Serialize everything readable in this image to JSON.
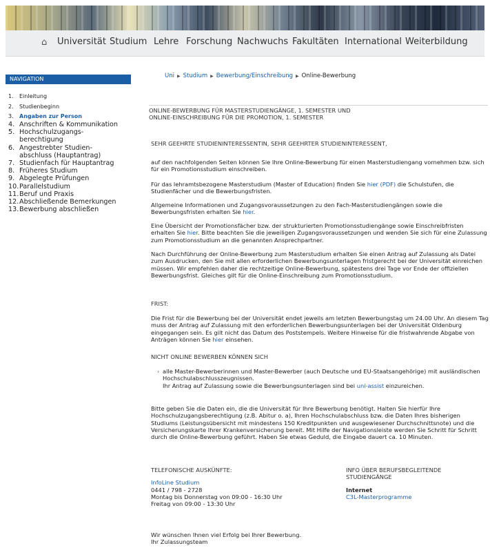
{
  "header": {
    "nav": [
      "Universität",
      "Studium",
      "Lehre",
      "Forschung",
      "Nachwuchs",
      "Fakultäten",
      "International",
      "Weiterbildung"
    ],
    "home_icon": "home-icon"
  },
  "sidebar": {
    "heading": "NAVIGATION",
    "items": [
      {
        "num": "1.",
        "label": "Einleitung"
      },
      {
        "num": "2.",
        "label": "Studienbeginn"
      },
      {
        "num": "3.",
        "label": "Angaben zur Person"
      },
      {
        "num": "4.",
        "label": "Anschriften & Kommunikation"
      },
      {
        "num": "5.",
        "label": "Hochschulzugangs-"
      },
      {
        "num": "",
        "label": "berechtigung"
      },
      {
        "num": "6.",
        "label": "Angestrebter Studien-"
      },
      {
        "num": "",
        "label": "abschluss (Hauptantrag)"
      },
      {
        "num": "7.",
        "label": "Studienfach für Hauptantrag"
      },
      {
        "num": "8.",
        "label": "Früheres Studium"
      },
      {
        "num": "9.",
        "label": "Abgelegte Prüfungen"
      },
      {
        "num": "10.",
        "label": "Parallelstudium"
      },
      {
        "num": "11.",
        "label": "Beruf und Praxis"
      },
      {
        "num": "12.",
        "label": "Abschließende Bemerkungen"
      },
      {
        "num": "13.",
        "label": "Bewerbung abschließen"
      }
    ]
  },
  "breadcrumb": {
    "items": [
      "Uni",
      "Studium",
      "Bewerbung/Einschreibung"
    ],
    "current": "Online-Bewerbung"
  },
  "content": {
    "title_line1": "ONLINE-BEWERBUNG FÜR MASTERSTUDIENGÄNGE, 1. SEMESTER UND",
    "title_line2": "ONLINE-EINSCHREIBUNG FÜR DIE PROMOTION, 1. SEMESTER",
    "greeting": "SEHR GEEHRTE STUDIENINTERESSENTIN, SEHR GEEHRTER STUDIENINTERESSENT,",
    "p1": "auf den nachfolgenden Seiten können Sie Ihre Online-Bewerbung für einen Masterstudiengang vornehmen bzw. sich für ein Promotionsstudium einschreiben.",
    "p2_a": "Für das lehramtsbezogene Masterstudium (Master of Education) finden Sie ",
    "p2_link": "hier (PDF)",
    "p2_b": " die Schulstufen, die Studienfächer und die Bewerbungsfristen.",
    "p3_a": "Allgemeine Informationen und Zugangsvoraussetzungen zu den Fach-Masterstudiengängen sowie die Bewerbungsfristen erhalten Sie ",
    "p3_link": "hier",
    "p3_b": ".",
    "p4_a": "Eine Übersicht der Promotionsfächer bzw. der strukturierten Promotionsstudiengänge sowie Einschreibfristen erhalten Sie ",
    "p4_link": "hier",
    "p4_b": ". Bitte beachten Sie die jeweiligen Zugangsvoraussetzungen und wenden Sie sich für eine Zulassung zum Promotionsstudium an die genannten Ansprechpartner.",
    "p5": "Nach Durchführung der Online-Bewerbung zum Masterstudium erhalten Sie einen Antrag auf Zulassung als Datei zum Ausdrucken, den Sie mit allen erforderlichen Bewerbungsunterlagen fristgerecht bei der Universität einreichen müssen. Wir empfehlen daher die rechtzeitige Online-Bewerbung, spätestens drei Tage vor Ende der offiziellen Bewerbungsfrist. Gleiches gilt für die Online-Einschreibung zum Promotionsstudium.",
    "frist_heading": "FRIST:",
    "frist_a": "Die Frist für die Bewerbung bei der Universität endet jeweils am letzten Bewerbungstag um 24.00 Uhr. An diesem Tag muss der Antrag auf Zulassung mit den erforderlichen Bewerbungsunterlagen bei der Universität Oldenburg eingegangen sein. Es gilt nicht das Datum des Poststempels. Weitere Hinweise für die fristwahrende Abgabe von Anträgen können Sie ",
    "frist_link": "hier",
    "frist_b": " einsehen.",
    "nicht_heading": "NICHT ONLINE BEWERBEN KÖNNEN SICH",
    "bullet_1": "alle Master-Bewerberinnen und Master-Bewerber (auch Deutsche und EU-Staatsangehörige) mit ausländischen Hochschulabschlusszeugnissen.",
    "bullet_2a": "Ihr Antrag auf Zulassung sowie die Bewerbungsunterlagen sind bei ",
    "bullet_2_link": "uni-assist",
    "bullet_2b": " einzureichen.",
    "p6": "Bitte geben Sie die Daten ein, die die Universität für Ihre Bewerbung benötigt. Halten Sie hierfür Ihre Hochschulzugangsberechtigung (z.B. Abitur o. a), Ihren Hochschulabschluss bzw. die Daten Ihres bisherigen Studiums (Leistungsübersicht mit mindestens 150 Kreditpunkten und ausgewiesener Durchschnittsnote) und die Versicherungskarte Ihrer Krankenversicherung bereit. Mit Hilfe der Navigationsleiste werden Sie Schritt für Schritt durch die Online-Bewerbung geführt. Haben Sie etwas Geduld, die Eingabe dauert ca. 10 Minuten.",
    "tel_heading": "TELEFONISCHE AUSKÜNFTE:",
    "tel_link": "InfoLine Studium",
    "tel_number": "0441 / 798 - 2728",
    "tel_hours1": "Montag bis Donnerstag von 09:00 - 16:30 Uhr",
    "tel_hours2": "Freitag von 09:00 - 13:30 Uhr",
    "info_heading1": "INFO ÜBER BERUFSBEGLEITENDE",
    "info_heading2": "STUDIENGÄNGE",
    "info_bold": "Internet",
    "info_link": "C3L-Masterprogramme",
    "closing1": "Wir wünschen Ihnen viel Erfolg bei Ihrer Bewerbung.",
    "closing2": "Ihr Zulassungsteam"
  }
}
